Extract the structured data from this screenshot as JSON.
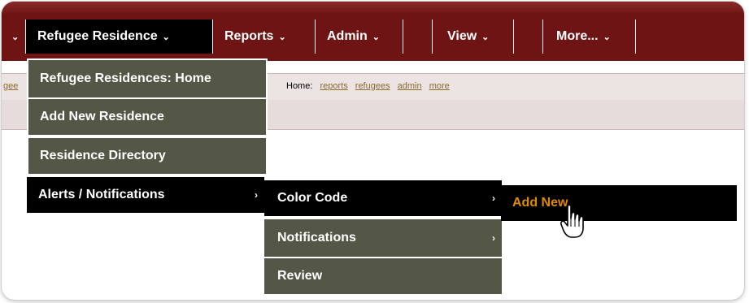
{
  "nav": {
    "left_chevron": "⌄",
    "items": [
      {
        "label": "Refugee Residence",
        "chev": "⌄"
      },
      {
        "label": "Reports",
        "chev": "⌄"
      },
      {
        "label": "Admin",
        "chev": "⌄"
      },
      {
        "label": "View",
        "chev": "⌄"
      },
      {
        "label": "More...",
        "chev": "⌄"
      }
    ]
  },
  "breadcrumb": {
    "left_fragment": "gee",
    "prefix": "Home:",
    "links": [
      "reports",
      "refugees",
      "admin",
      "more"
    ]
  },
  "menu_level1": [
    {
      "label": "Refugee Residences: Home"
    },
    {
      "label": "Add New Residence"
    },
    {
      "label": "Residence Directory"
    },
    {
      "label": "Alerts / Notifications",
      "arrow": "›"
    }
  ],
  "menu_level2": [
    {
      "label": "Color Code",
      "arrow": "›"
    },
    {
      "label": "Notifications",
      "arrow": "›"
    },
    {
      "label": "Review"
    }
  ],
  "menu_level3": [
    {
      "label": "Add New",
      "color": "#e08a00"
    }
  ],
  "colors": {
    "topbar": "#6e1414",
    "menu_olive": "#555746",
    "menu_active": "#000000",
    "hover_text": "#e08a00"
  }
}
